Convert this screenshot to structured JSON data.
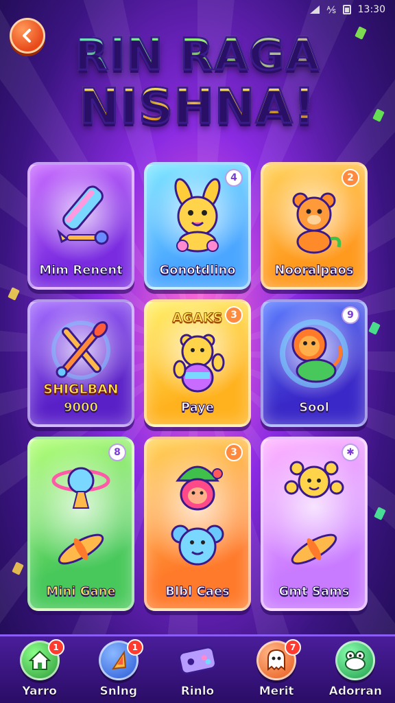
{
  "status_bar": {
    "time": "13:30"
  },
  "title": {
    "line1": "RIN RAGA",
    "line2": "NISHNA!"
  },
  "cards": [
    {
      "label": "Mim Renent",
      "badge": "",
      "icon": "pencil-icon"
    },
    {
      "label": "Gonotdlino",
      "badge": "4",
      "icon": "bunny-icon"
    },
    {
      "label": "Nooralpaos",
      "badge": "2",
      "icon": "bear-icon"
    },
    {
      "label": "SHIGLBAN",
      "sublabel": "9000",
      "badge": "",
      "icon": "paintbrush-icon"
    },
    {
      "label": "Paye",
      "toplabel": "AGAKS",
      "badge": "3",
      "icon": "teddy-bear-icon"
    },
    {
      "label": "Sool",
      "badge": "9",
      "icon": "lion-icon"
    },
    {
      "label": "Mini Gane",
      "badge": "8",
      "icon": "planet-icon"
    },
    {
      "label": "Blbl Caes",
      "badge": "3",
      "icon": "elf-icon"
    },
    {
      "label": "Gmt Sams",
      "badge": "✱",
      "icon": "star-creature-icon"
    }
  ],
  "bottom_nav": [
    {
      "label": "Yarro",
      "badge": "1",
      "icon": "home-icon",
      "color": "#3fc04a"
    },
    {
      "label": "Snlng",
      "badge": "1",
      "icon": "triangle-icon",
      "color": "#3a7bff"
    },
    {
      "label": "Rinlo",
      "badge": "",
      "icon": "gamepad-icon",
      "color": "#9b6bff"
    },
    {
      "label": "Merit",
      "badge": "7",
      "icon": "ghost-icon",
      "color": "#ff7a2a"
    },
    {
      "label": "Adorran",
      "badge": "",
      "icon": "frog-icon",
      "color": "#2fc060"
    }
  ]
}
